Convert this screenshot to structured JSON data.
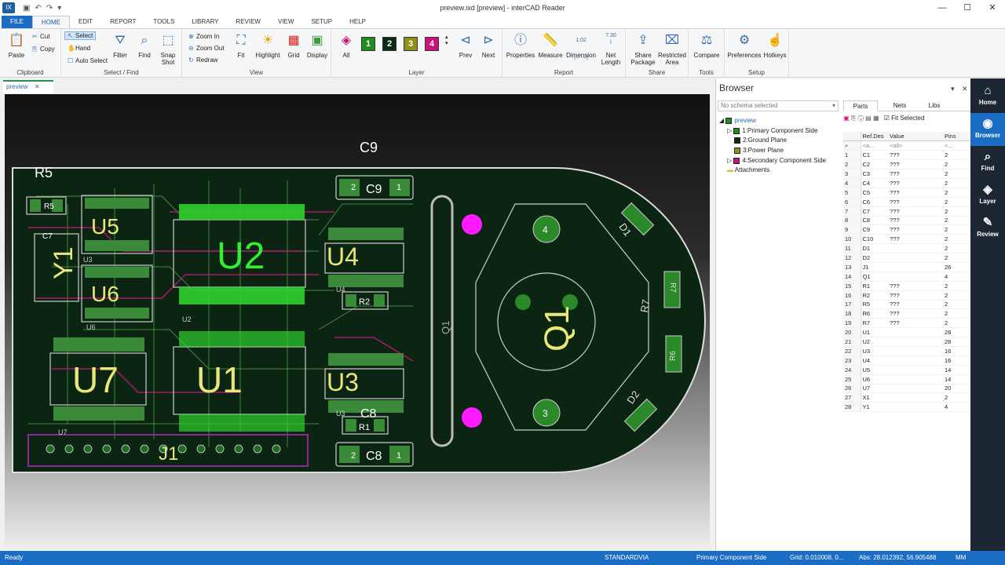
{
  "titlebar": {
    "title": "preview.ixd [preview] - interCAD Reader",
    "app_icon": "app-icon",
    "min": "—",
    "max": "☐",
    "close": "✕"
  },
  "tabs": [
    "FILE",
    "HOME",
    "EDIT",
    "REPORT",
    "TOOLS",
    "LIBRARY",
    "REVIEW",
    "VIEW",
    "SETUP",
    "HELP"
  ],
  "ribbon": {
    "clipboard": {
      "paste": "Paste",
      "cut": "Cut",
      "copy": "Copy",
      "label": "Clipboard"
    },
    "select": {
      "select": "Select",
      "hand": "Hand",
      "auto_select": "Auto Select",
      "filter": "Filter",
      "find": "Find",
      "snapshot_1": "Snap",
      "snapshot_2": "Shot",
      "label": "Select / Find"
    },
    "view": {
      "zoom_in": "Zoom In",
      "zoom_out": "Zoom Out",
      "redraw": "Redraw",
      "fit": "Fit",
      "highlight": "Highlight",
      "grid": "Grid",
      "display": "Display",
      "label": "View"
    },
    "layer": {
      "all": "All",
      "layers": [
        "1",
        "2",
        "3",
        "4"
      ],
      "colors": [
        "#1e8f1e",
        "#0c2a12",
        "#8f8f1a",
        "#c8147a"
      ],
      "prev": "Prev",
      "next": "Next",
      "label": "Layer"
    },
    "report": {
      "properties": "Properties",
      "measure": "Measure",
      "dimension": "Dimension",
      "dim_value": "1.02",
      "net_length_1": "Net",
      "net_length_2": "Length",
      "net_value": "7.30",
      "label": "Report"
    },
    "share": {
      "share_package_1": "Share",
      "share_package_2": "Package",
      "restricted_1": "Restricted",
      "restricted_2": "Area",
      "label": "Share"
    },
    "tools": {
      "compare": "Compare",
      "label": "Tools"
    },
    "setup": {
      "preferences": "Preferences",
      "hotkeys": "Hotkeys",
      "label": "Setup"
    }
  },
  "document": {
    "tab": "preview"
  },
  "pcb": {
    "labels": {
      "c9_top": "C9",
      "r5": "R5",
      "u5": "U5",
      "u6": "U6",
      "u7": "U7",
      "u2": "U2",
      "u1": "U1",
      "u4": "U4",
      "u3": "U3",
      "y1": "Y1",
      "j1": "J1",
      "q1": "Q1",
      "q1_side": "Q1",
      "c9": "C9",
      "c8": "C8",
      "c8_top": "C8",
      "r1": "R1",
      "r2": "R2",
      "r2b": "R2",
      "r1b": "R1",
      "c7": "C7",
      "r5b": "R5",
      "d1": "D1",
      "d2": "D2",
      "r7": "R7",
      "r6": "R6",
      "r7b": "R7",
      "r6b": "R6",
      "u4s": "U4",
      "u3s": "U3",
      "u2s": "U2",
      "u6s": "U6",
      "u7s": "U7",
      "u5s": "U3",
      "n1": "1",
      "n2": "2",
      "n4": "4",
      "n3": "3"
    }
  },
  "browser": {
    "title": "Browser",
    "schema": "No schema selected",
    "tree": {
      "root": "preview",
      "layers": [
        {
          "name": "1:Primary Component Side",
          "color": "#1e8f1e"
        },
        {
          "name": "2:Ground Plane",
          "color": "#0c2a12"
        },
        {
          "name": "3:Power Plane",
          "color": "#8f8f1a"
        },
        {
          "name": "4:Secondary Component Side",
          "color": "#c8147a"
        }
      ],
      "attachments": "Attachments"
    },
    "part_tabs": [
      "Parts",
      "Nets",
      "Libs"
    ],
    "fit_selected": "Fit Selected",
    "columns": [
      "Ref.Des",
      "Value",
      "Pins"
    ],
    "filters": {
      "refdes": "<a...",
      "value": "<all>",
      "pins": "<..."
    },
    "rows": [
      [
        "1",
        "C1",
        "???",
        "2"
      ],
      [
        "2",
        "C2",
        "???",
        "2"
      ],
      [
        "3",
        "C3",
        "???",
        "2"
      ],
      [
        "4",
        "C4",
        "???",
        "2"
      ],
      [
        "5",
        "C5",
        "???",
        "2"
      ],
      [
        "6",
        "C6",
        "???",
        "2"
      ],
      [
        "7",
        "C7",
        "???",
        "2"
      ],
      [
        "8",
        "C8",
        "???",
        "2"
      ],
      [
        "9",
        "C9",
        "???",
        "2"
      ],
      [
        "10",
        "C10",
        "???",
        "2"
      ],
      [
        "11",
        "D1",
        "",
        "2"
      ],
      [
        "12",
        "D2",
        "",
        "2"
      ],
      [
        "13",
        "J1",
        "",
        "26"
      ],
      [
        "14",
        "Q1",
        "",
        "4"
      ],
      [
        "15",
        "R1",
        "???",
        "2"
      ],
      [
        "16",
        "R2",
        "???",
        "2"
      ],
      [
        "17",
        "R5",
        "???",
        "2"
      ],
      [
        "18",
        "R6",
        "???",
        "2"
      ],
      [
        "19",
        "R7",
        "???",
        "2"
      ],
      [
        "20",
        "U1",
        "",
        "28"
      ],
      [
        "21",
        "U2",
        "",
        "28"
      ],
      [
        "22",
        "U3",
        "",
        "16"
      ],
      [
        "23",
        "U4",
        "",
        "16"
      ],
      [
        "24",
        "U5",
        "",
        "14"
      ],
      [
        "25",
        "U6",
        "",
        "14"
      ],
      [
        "26",
        "U7",
        "",
        "20"
      ],
      [
        "27",
        "X1",
        "",
        "2"
      ],
      [
        "28",
        "Y1",
        "",
        "4"
      ]
    ]
  },
  "sidebar": [
    {
      "label": "Home",
      "icon": "home-icon"
    },
    {
      "label": "Browser",
      "icon": "browser-icon"
    },
    {
      "label": "Find",
      "icon": "find-icon"
    },
    {
      "label": "Layer",
      "icon": "layer-icon"
    },
    {
      "label": "Review",
      "icon": "review-icon"
    }
  ],
  "status": {
    "ready": "Ready",
    "via": "STANDARDVIA",
    "layer": "Primary Component Side",
    "grid": "Grid: 0.010008, 0...",
    "abs": "Abs: 28.012392, 56.905488",
    "units": "MM"
  }
}
